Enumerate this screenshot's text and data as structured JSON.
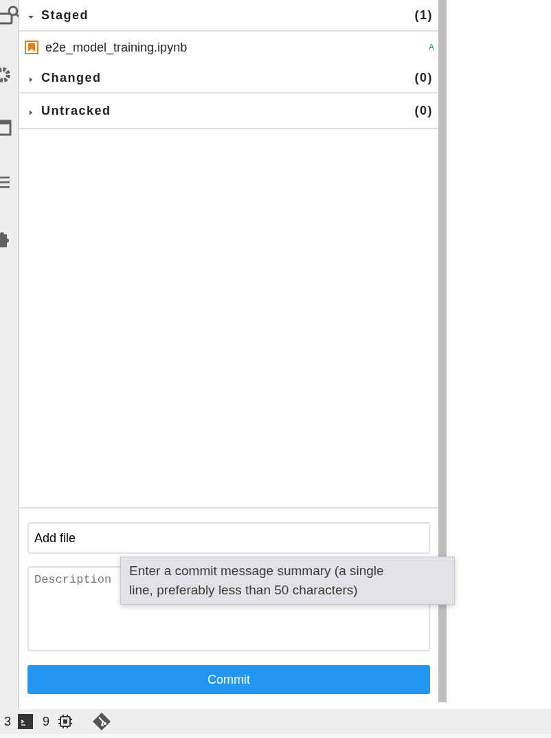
{
  "sections": [
    {
      "title": "Staged",
      "count": "(1)",
      "expanded": true,
      "files": [
        {
          "name": "e2e_model_training.ipynb",
          "status": "A"
        }
      ]
    },
    {
      "title": "Changed",
      "count": "(0)",
      "expanded": false
    },
    {
      "title": "Untracked",
      "count": "(0)",
      "expanded": false
    }
  ],
  "commit": {
    "summary": "Add file",
    "description_placeholder": "Description",
    "button": "Commit",
    "tooltip": "Enter a commit message summary (a single line, preferably less than 50 characters)"
  },
  "status_bar": {
    "terminals": "3",
    "kernels": "9"
  }
}
